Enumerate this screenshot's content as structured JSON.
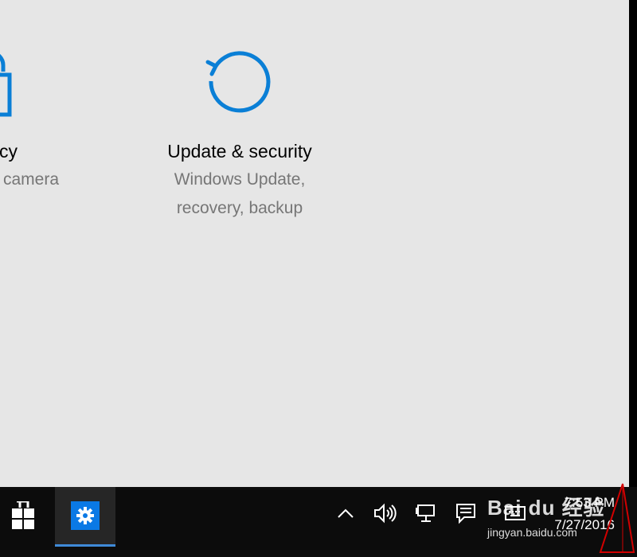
{
  "tiles": [
    {
      "id": "privacy",
      "title": "cy",
      "desc_lines": [
        "camera"
      ]
    },
    {
      "id": "update",
      "title": "Update & security",
      "desc_lines": [
        "Windows Update,",
        "recovery, backup"
      ]
    }
  ],
  "taskbar": {
    "start_icon": "windows-logo-icon",
    "pinned": [
      {
        "name": "settings",
        "icon": "gear-icon"
      }
    ],
    "tray_icons": [
      "chevron-up-icon",
      "volume-icon",
      "network-icon",
      "action-center-icon",
      "keyboard-icon"
    ],
    "clock": {
      "time": "7:53 PM",
      "date": "7/27/2016"
    }
  },
  "watermark": {
    "logo": "Bai du 经验",
    "url": "jingyan.baidu.com"
  },
  "colors": {
    "accent": "#0a79e5",
    "icon_blue": "#0a7fd6",
    "desc_gray": "#767676",
    "bg": "#e6e6e6",
    "taskbar": "#0c0c0c",
    "marker_red": "#d10000"
  }
}
